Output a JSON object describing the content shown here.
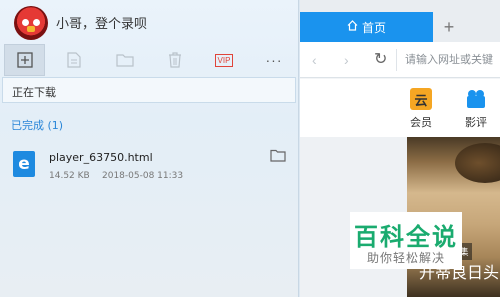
{
  "user": {
    "name": "小哥，登个录呗"
  },
  "toolbar": {
    "items": [
      {
        "name": "new-task-icon",
        "active": true
      },
      {
        "name": "document-icon"
      },
      {
        "name": "folder-icon"
      },
      {
        "name": "trash-icon"
      },
      {
        "name": "vip-icon",
        "label": "VIP"
      },
      {
        "name": "more-icon",
        "label": "···"
      }
    ]
  },
  "downloads": {
    "in_progress_label": "正在下载",
    "completed_label": "已完成 (1)",
    "files": [
      {
        "icon_letter": "e",
        "name": "player_63750.html",
        "size": "14.52 KB",
        "date": "2018-05-08 11:33"
      }
    ]
  },
  "browser": {
    "tab_label": "首页",
    "new_tab": "+",
    "address_placeholder": "请输入网址或关键",
    "quick_links": [
      {
        "icon_text": "云",
        "label": "会员",
        "color": "#f5a623"
      },
      {
        "icon_text": "",
        "label": "影评",
        "color": "#1a93ee"
      }
    ],
    "poster": {
      "badge": "更新至10集",
      "caption": "开蒂良日头"
    }
  },
  "watermark": {
    "title": "百科全说",
    "subtitle": "助你轻松解决"
  }
}
